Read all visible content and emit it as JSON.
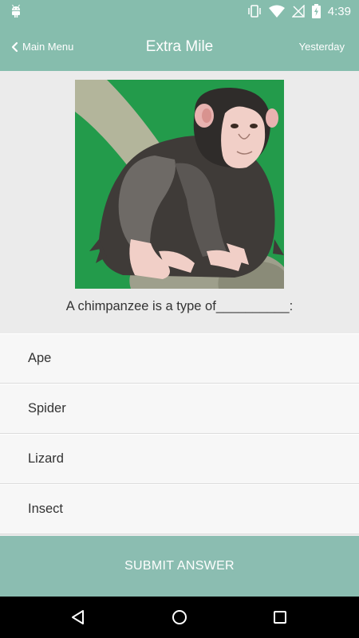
{
  "status_bar": {
    "time": "4:39",
    "icons": [
      "android-debug-icon",
      "vibrate-icon",
      "wifi-icon",
      "no-signal-icon",
      "battery-charging-icon"
    ]
  },
  "app_bar": {
    "back_label": "Main Menu",
    "title": "Extra Mile",
    "date_label": "Yesterday"
  },
  "question": {
    "image": "chimpanzee-illustration",
    "text": "A chimpanzee is a type of__________:"
  },
  "answers": [
    {
      "label": "Ape"
    },
    {
      "label": "Spider"
    },
    {
      "label": "Lizard"
    },
    {
      "label": "Insect"
    }
  ],
  "submit_label": "SUBMIT ANSWER",
  "colors": {
    "accent": "#86bdad",
    "submit": "#8bbdb1",
    "background": "#ebebeb",
    "answer_bg": "#f7f7f7",
    "image_bg": "#239b4b"
  },
  "nav_bar": {
    "icons": [
      "back-icon",
      "home-icon",
      "recents-icon"
    ]
  }
}
